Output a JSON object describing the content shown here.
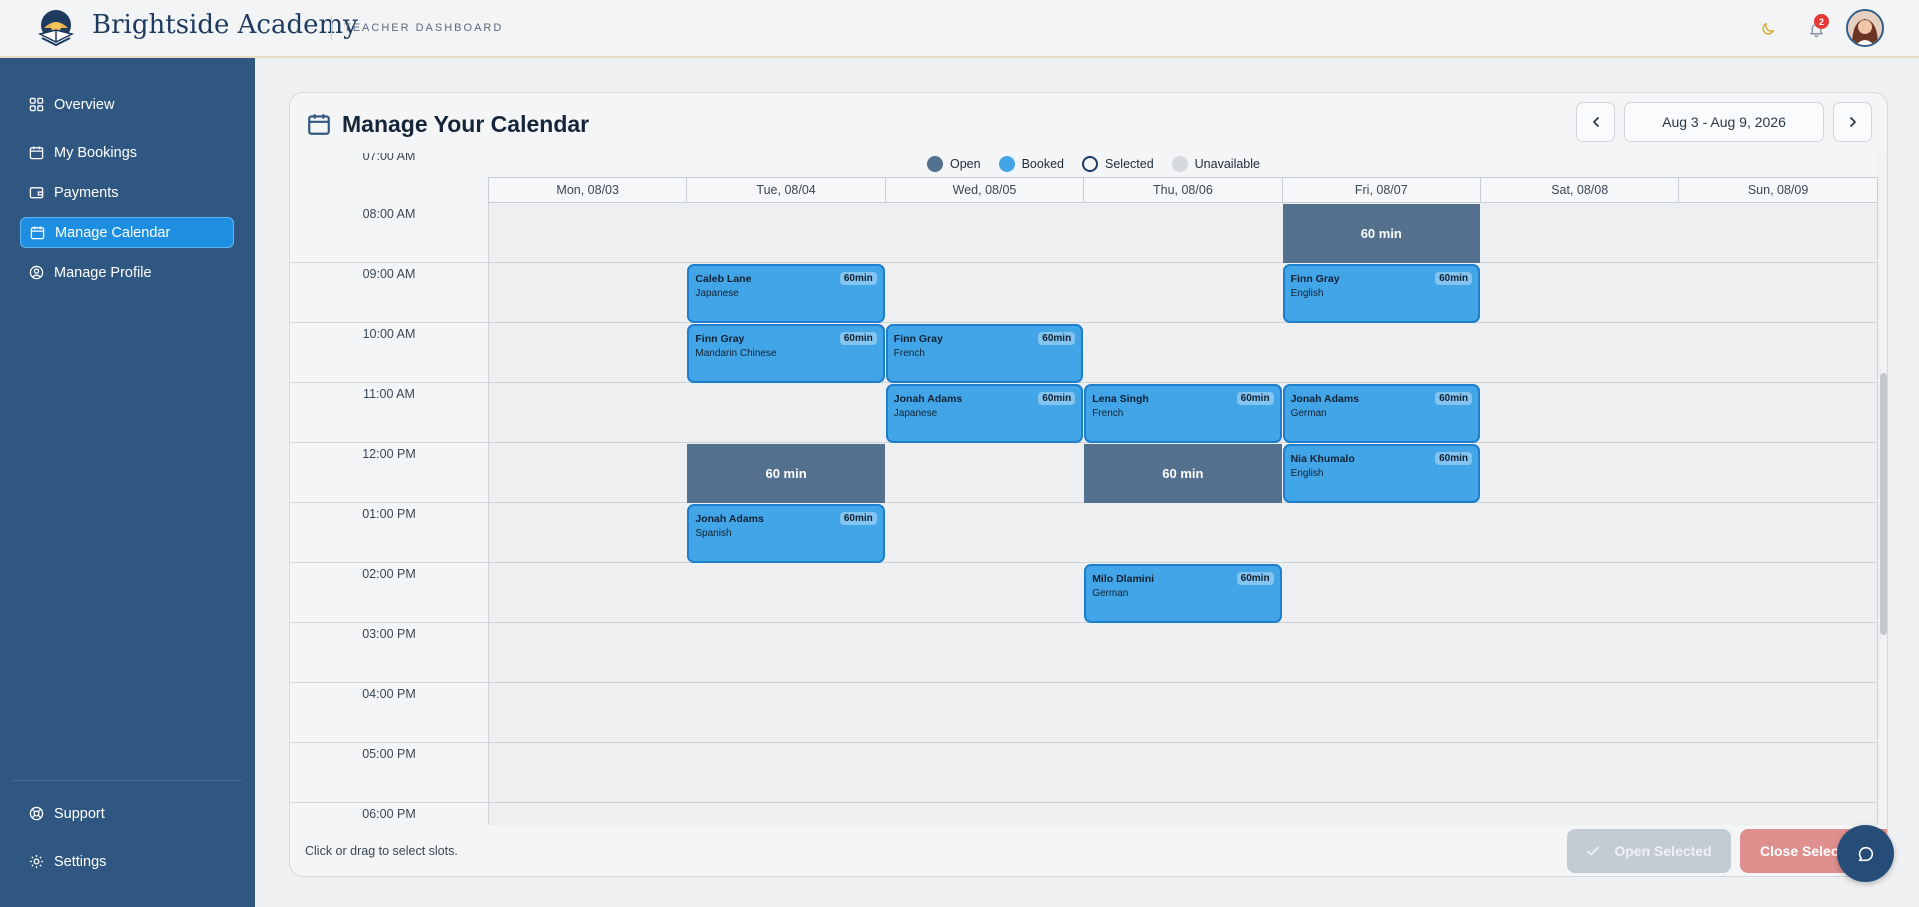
{
  "header": {
    "brand_name": "Brightside Academy",
    "brand_sub": "TEACHER DASHBOARD",
    "notif_count": "2",
    "icons": [
      "moon-icon",
      "bell-icon"
    ]
  },
  "sidebar": {
    "items": [
      {
        "label": "Overview",
        "icon": "grid-icon",
        "active": false
      },
      {
        "label": "My Bookings",
        "icon": "calendar-icon",
        "active": false
      },
      {
        "label": "Payments",
        "icon": "wallet-icon",
        "active": false
      },
      {
        "label": "Manage Calendar",
        "icon": "calendar-icon",
        "active": true
      },
      {
        "label": "Manage Profile",
        "icon": "user-circle-icon",
        "active": false
      }
    ],
    "bottom": [
      {
        "label": "Support",
        "icon": "support-icon"
      },
      {
        "label": "Settings",
        "icon": "gear-icon"
      }
    ]
  },
  "panel": {
    "title": "Manage Your Calendar",
    "date_range": "Aug 3 - Aug 9, 2026"
  },
  "legend": [
    {
      "label": "Open",
      "color": "#53708f",
      "style": "filled"
    },
    {
      "label": "Booked",
      "color": "#42a5e8",
      "style": "filled"
    },
    {
      "label": "Selected",
      "color": "#1e3a5f",
      "style": "ring"
    },
    {
      "label": "Unavailable",
      "color": "#d5d8dc",
      "style": "filled"
    }
  ],
  "days": [
    "Mon, 08/03",
    "Tue, 08/04",
    "Wed, 08/05",
    "Thu, 08/06",
    "Fri, 08/07",
    "Sat, 08/08",
    "Sun, 08/09"
  ],
  "times": [
    "07:00 AM",
    "08:00 AM",
    "09:00 AM",
    "10:00 AM",
    "11:00 AM",
    "12:00 PM",
    "01:00 PM",
    "02:00 PM",
    "03:00 PM",
    "04:00 PM",
    "05:00 PM",
    "06:00 PM"
  ],
  "slots": [
    {
      "day": 4,
      "hour": "08:00 AM",
      "type": "open",
      "label": "60 min"
    },
    {
      "day": 1,
      "hour": "09:00 AM",
      "type": "booked",
      "name": "Caleb Lane",
      "subject": "Japanese",
      "duration": "60min"
    },
    {
      "day": 4,
      "hour": "09:00 AM",
      "type": "booked",
      "name": "Finn Gray",
      "subject": "English",
      "duration": "60min"
    },
    {
      "day": 1,
      "hour": "10:00 AM",
      "type": "booked",
      "name": "Finn Gray",
      "subject": "Mandarin Chinese",
      "duration": "60min"
    },
    {
      "day": 2,
      "hour": "10:00 AM",
      "type": "booked",
      "name": "Finn Gray",
      "subject": "French",
      "duration": "60min"
    },
    {
      "day": 2,
      "hour": "11:00 AM",
      "type": "booked",
      "name": "Jonah Adams",
      "subject": "Japanese",
      "duration": "60min"
    },
    {
      "day": 3,
      "hour": "11:00 AM",
      "type": "booked",
      "name": "Lena Singh",
      "subject": "French",
      "duration": "60min"
    },
    {
      "day": 4,
      "hour": "11:00 AM",
      "type": "booked",
      "name": "Jonah Adams",
      "subject": "German",
      "duration": "60min"
    },
    {
      "day": 1,
      "hour": "12:00 PM",
      "type": "open",
      "label": "60 min"
    },
    {
      "day": 3,
      "hour": "12:00 PM",
      "type": "open",
      "label": "60 min"
    },
    {
      "day": 4,
      "hour": "12:00 PM",
      "type": "booked",
      "name": "Nia Khumalo",
      "subject": "English",
      "duration": "60min"
    },
    {
      "day": 1,
      "hour": "01:00 PM",
      "type": "booked",
      "name": "Jonah Adams",
      "subject": "Spanish",
      "duration": "60min"
    },
    {
      "day": 3,
      "hour": "02:00 PM",
      "type": "booked",
      "name": "Milo Dlamini",
      "subject": "German",
      "duration": "60min"
    }
  ],
  "footer": {
    "hint": "Click or drag to select slots.",
    "open_selected": "Open Selected",
    "close_selected": "Close Select"
  }
}
